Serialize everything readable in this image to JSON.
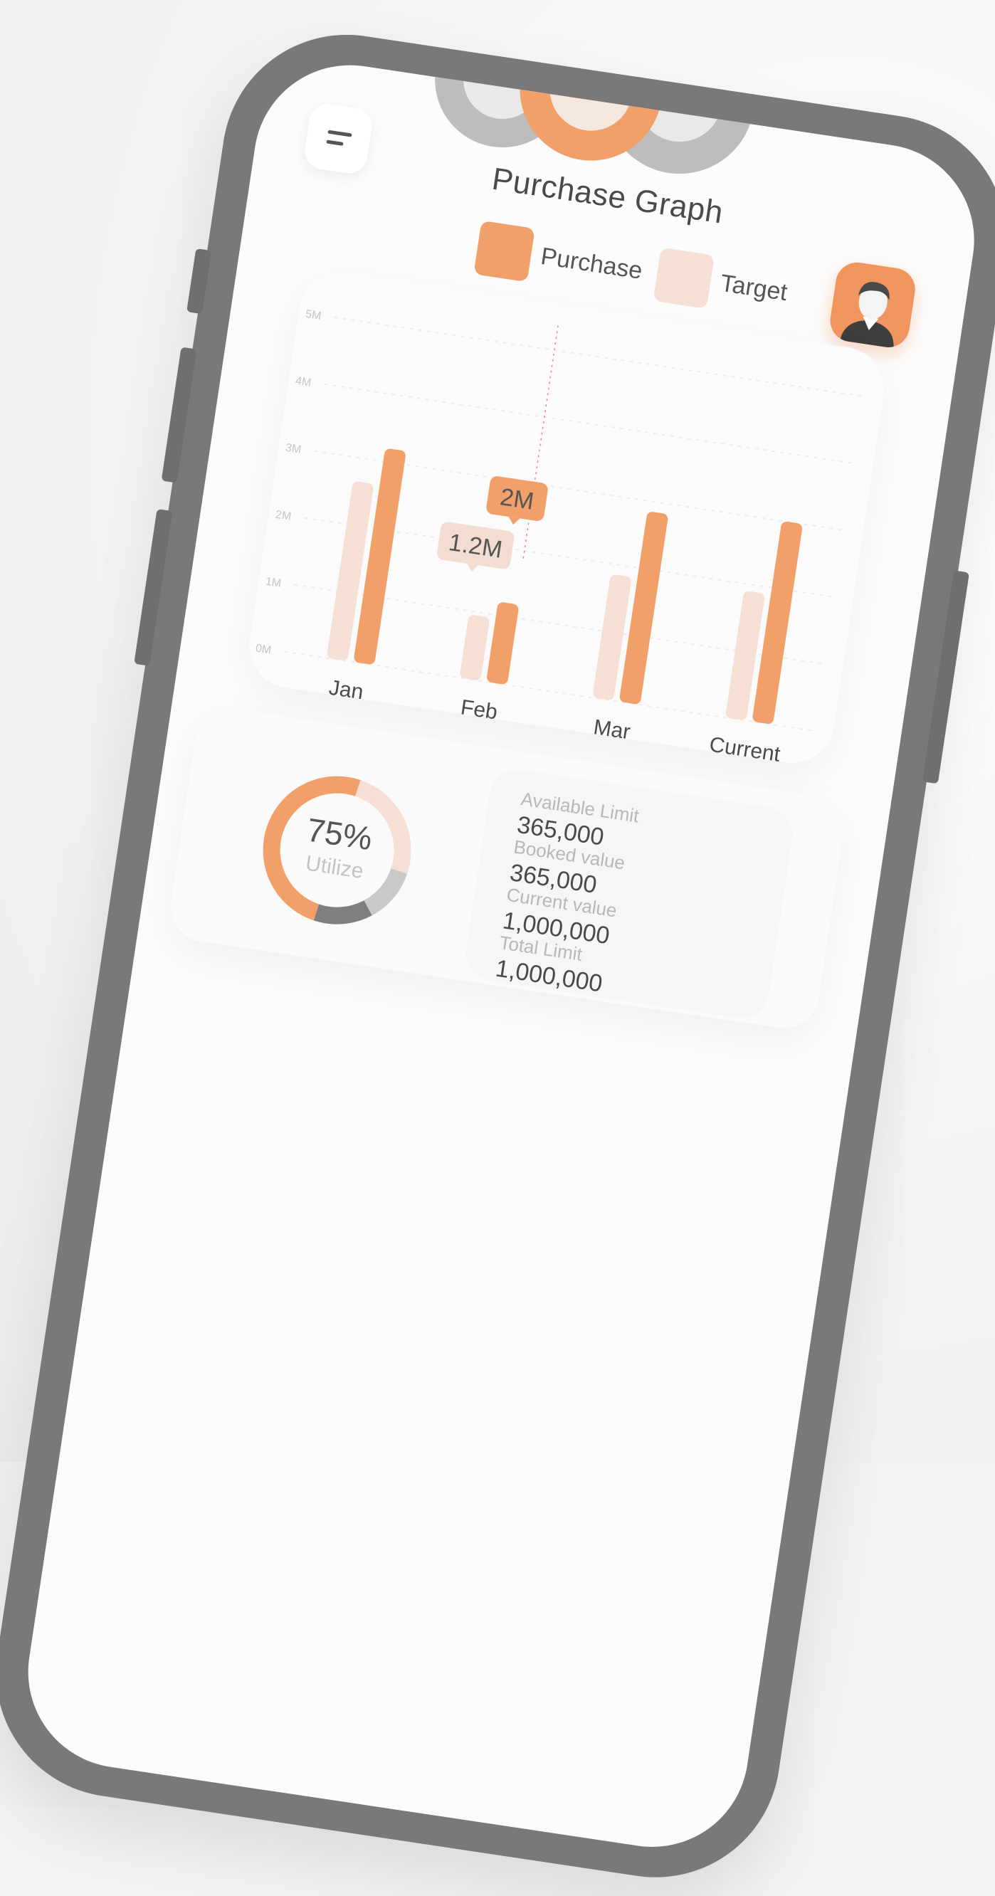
{
  "header": {
    "title": "Purchase Graph"
  },
  "legend": {
    "purchase_label": "Purchase",
    "target_label": "Target"
  },
  "colors": {
    "purchase": "#f2a06a",
    "target": "#f6e0d6",
    "grey": "#8c8c8c",
    "phone_frame": "#797979"
  },
  "icons": {
    "menu": "menu-icon",
    "avatar": "user-avatar-icon"
  },
  "chart_data": {
    "type": "bar",
    "categories": [
      "Jan",
      "Feb",
      "Mar",
      "Current"
    ],
    "series": [
      {
        "name": "Target",
        "values": [
          2.65,
          0.95,
          1.85,
          1.9
        ]
      },
      {
        "name": "Purchase",
        "values": [
          3.2,
          1.2,
          2.85,
          3.0
        ]
      }
    ],
    "y_ticks": [
      "0M",
      "1M",
      "2M",
      "3M",
      "4M",
      "5M"
    ],
    "ylim": [
      0,
      5
    ],
    "grid": true,
    "tooltips": [
      {
        "category": "Feb",
        "series": "Purchase",
        "label": "2M"
      },
      {
        "category": "Feb",
        "series": "Target",
        "label": "1.2M"
      }
    ]
  },
  "utilization": {
    "percent_label": "75%",
    "sub_label": "Utilize",
    "segments": [
      {
        "color": "#f2a06a",
        "fraction": 0.5
      },
      {
        "color": "#f6e0d6",
        "fraction": 0.25
      },
      {
        "color": "#c9c9c9",
        "fraction": 0.12
      },
      {
        "color": "#7f7f7f",
        "fraction": 0.13
      }
    ]
  },
  "stats": [
    {
      "label": "Available Limit",
      "value": "365,000"
    },
    {
      "label": "Booked value",
      "value": "365,000"
    },
    {
      "label": "Current value",
      "value": "1,000,000"
    },
    {
      "label": "Total Limit",
      "value": "1,000,000"
    }
  ]
}
